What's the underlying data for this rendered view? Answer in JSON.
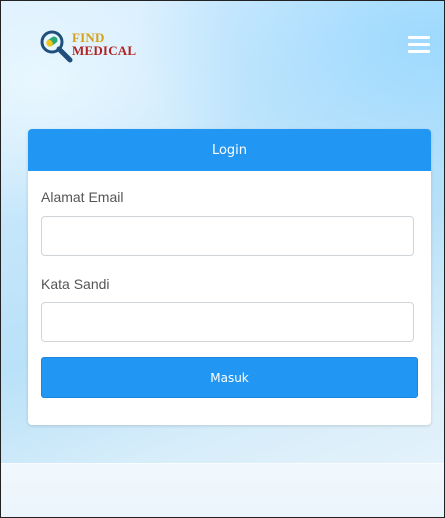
{
  "brand": {
    "logo_line1": "FIND",
    "logo_line2": "MEDICAL",
    "icon": "magnifier-pill-icon"
  },
  "nav": {
    "menu_icon": "hamburger-menu-icon"
  },
  "login": {
    "title": "Login",
    "email_label": "Alamat Email",
    "email_value": "",
    "password_label": "Kata Sandi",
    "password_value": "",
    "submit_label": "Masuk"
  },
  "colors": {
    "accent": "#2196f3",
    "logo_gold": "#d4a017",
    "logo_red": "#b22222"
  }
}
